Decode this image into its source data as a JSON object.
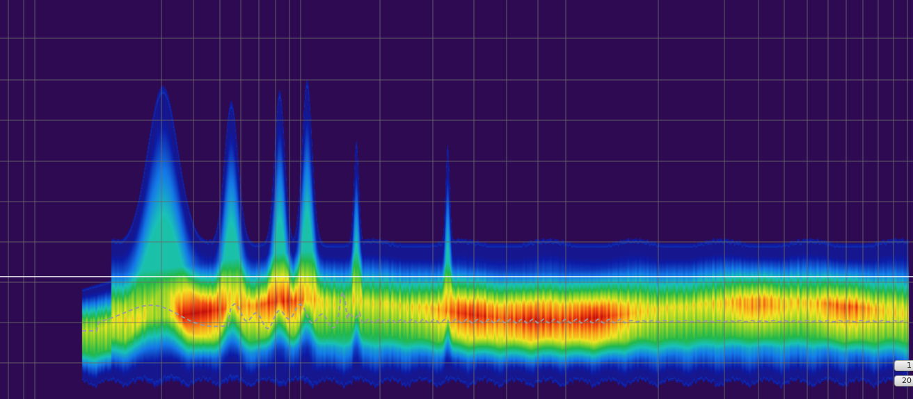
{
  "chart_data": {
    "type": "heatmap",
    "title": "",
    "xlabel": "",
    "ylabel": "",
    "colormap": [
      "#2e0a52",
      "#0d1ca6",
      "#1479e8",
      "#19c2b8",
      "#22b84b",
      "#8fd32a",
      "#f2e523",
      "#f7a21c",
      "#f04a14",
      "#c40f0a"
    ],
    "background": "#2e0a52",
    "grid": true,
    "grid_color": "#6b6b6b",
    "cursor_line_color": "#ffffff",
    "reference_curve": {
      "style": "dashed",
      "color": "#9a9a9a"
    },
    "peaks": [
      {
        "x": 0.178,
        "height": 0.72,
        "width": 0.035
      },
      {
        "x": 0.253,
        "height": 0.65,
        "width": 0.016
      },
      {
        "x": 0.306,
        "height": 0.7,
        "width": 0.012
      },
      {
        "x": 0.336,
        "height": 0.75,
        "width": 0.012
      },
      {
        "x": 0.39,
        "height": 0.47,
        "width": 0.006
      },
      {
        "x": 0.49,
        "height": 0.45,
        "width": 0.005
      }
    ],
    "hot_regions": [
      {
        "x": 0.215,
        "strength": 0.95
      },
      {
        "x": 0.306,
        "strength": 0.7
      },
      {
        "x": 0.515,
        "strength": 0.7
      },
      {
        "x": 0.585,
        "strength": 0.75
      },
      {
        "x": 0.652,
        "strength": 0.8
      },
      {
        "x": 0.83,
        "strength": 0.55
      },
      {
        "x": 0.925,
        "strength": 0.55
      }
    ]
  },
  "labels": {
    "top": "1",
    "bottom": "20"
  }
}
